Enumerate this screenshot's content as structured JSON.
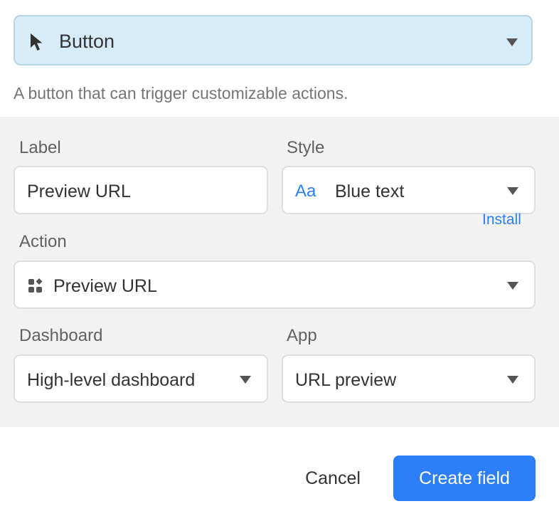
{
  "field_type": {
    "label": "Button",
    "icon": "cursor-arrow-icon",
    "description": "A button that can trigger customizable actions."
  },
  "label_field": {
    "label": "Label",
    "value": "Preview URL"
  },
  "style_field": {
    "label": "Style",
    "icon_text": "Aa",
    "value": "Blue text"
  },
  "action_field": {
    "label": "Action",
    "icon": "apps-icon",
    "value": "Preview URL"
  },
  "dashboard_field": {
    "label": "Dashboard",
    "value": "High-level dashboard"
  },
  "app_field": {
    "label": "App",
    "install_label": "Install",
    "value": "URL preview"
  },
  "footer": {
    "cancel_label": "Cancel",
    "create_label": "Create field"
  },
  "colors": {
    "accent": "#2d7ff9",
    "type_select_bg": "#d6ecf8",
    "options_bg": "#f2f2f2"
  }
}
